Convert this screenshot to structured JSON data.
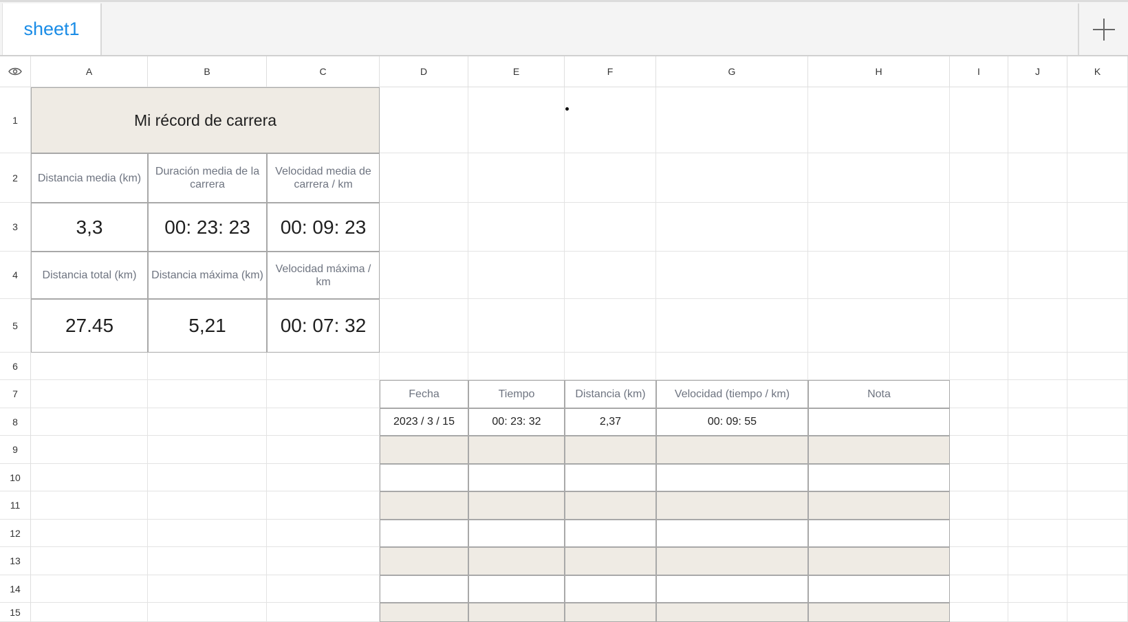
{
  "tabs": {
    "active": "sheet1"
  },
  "columns": [
    "A",
    "B",
    "C",
    "D",
    "E",
    "F",
    "G",
    "H",
    "I",
    "J",
    "K"
  ],
  "rows": [
    "1",
    "2",
    "3",
    "4",
    "5",
    "6",
    "7",
    "8",
    "9",
    "10",
    "11",
    "12",
    "13",
    "14",
    "15"
  ],
  "summary": {
    "title": "Mi récord de carrera",
    "labels_row2": [
      "Distancia media (km)",
      "Duración media de la carrera",
      "Velocidad media de carrera / km"
    ],
    "values_row3": [
      "3,3",
      "00: 23: 23",
      "00: 09: 23"
    ],
    "labels_row4": [
      "Distancia total (km)",
      "Distancia máxima (km)",
      "Velocidad máxima / km"
    ],
    "values_row5": [
      "27.45",
      "5,21",
      "00: 07: 32"
    ]
  },
  "log_table": {
    "headers": [
      "Fecha",
      "Tiempo",
      "Distancia (km)",
      "Velocidad (tiempo / km)",
      "Nota"
    ],
    "row8": [
      "2023 / 3 / 15",
      "00: 23: 32",
      "2,37",
      "00: 09: 55",
      ""
    ]
  },
  "colors": {
    "tab_text": "#1a8ce6",
    "band": "#efebe4",
    "label_text": "#6e7480"
  }
}
